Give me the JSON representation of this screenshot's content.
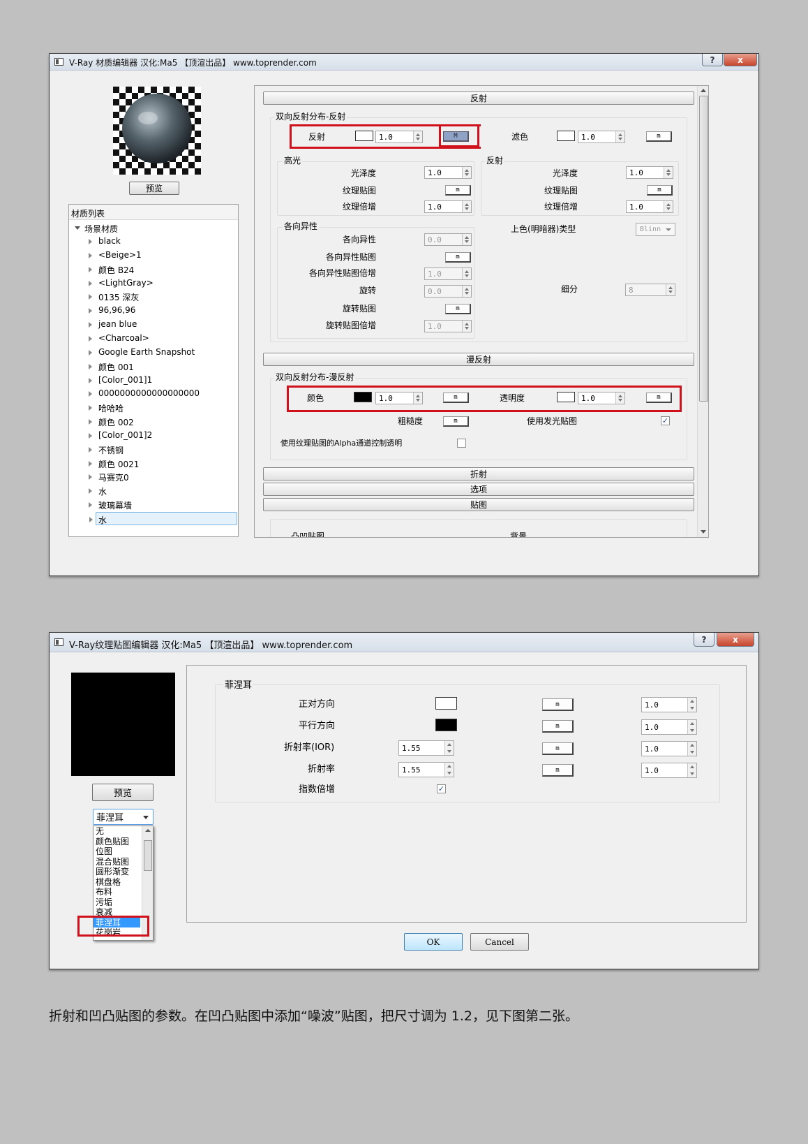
{
  "material_editor": {
    "title": "V-Ray 材质编辑器   汉化:Ma5   【顶渲出品】 www.toprender.com",
    "help_button": "?",
    "close_button": "x",
    "preview_button": "预览",
    "material_list": {
      "header": "材质列表",
      "root": "场景材质",
      "items": [
        "black",
        "<Beige>1",
        "颜色 B24",
        "<LightGray>",
        "0135 深灰",
        "96,96,96",
        "jean blue",
        "<Charcoal>",
        "Google Earth Snapshot",
        "颜色 001",
        "[Color_001]1",
        "0000000000000000000",
        "哈哈哈",
        "颜色 002",
        "[Color_001]2",
        "不锈钢",
        "颜色 0021",
        "马赛克0",
        "水",
        "玻璃幕墙",
        "水"
      ]
    },
    "reflection": {
      "rollout": "反射",
      "group": "双向反射分布-反射",
      "reflect_label": "反射",
      "reflect_value": "1.0",
      "reflect_map": "M",
      "filter_label": "滤色",
      "filter_value": "1.0",
      "filter_map": "m",
      "highlight": {
        "title": "高光",
        "gloss_label": "光泽度",
        "gloss_value": "1.0",
        "map_label": "纹理贴图",
        "map_btn": "m",
        "mult_label": "纹理倍增",
        "mult_value": "1.0"
      },
      "reflect_sub": {
        "title": "反射",
        "gloss_label": "光泽度",
        "gloss_value": "1.0",
        "map_label": "纹理贴图",
        "map_btn": "m",
        "mult_label": "纹理倍增",
        "mult_value": "1.0"
      },
      "anisotropy": {
        "title": "各向异性",
        "aniso_label": "各向异性",
        "aniso_value": "0.0",
        "aniso_map_label": "各向异性贴图",
        "aniso_map_btn": "m",
        "aniso_mult_label": "各向异性贴图倍增",
        "aniso_mult_value": "1.0",
        "rot_label": "旋转",
        "rot_value": "0.0",
        "rot_map_label": "旋转贴图",
        "rot_map_btn": "m",
        "rot_mult_label": "旋转贴图倍增",
        "rot_mult_value": "1.0"
      },
      "shader_type_label": "上色(明暗器)类型",
      "shader_type_value": "Blinn",
      "subdiv_label": "细分",
      "subdiv_value": "8"
    },
    "diffuse": {
      "rollout": "漫反射",
      "group": "双向反射分布-漫反射",
      "color_label": "颜色",
      "color_value": "1.0",
      "color_map": "m",
      "opacity_label": "透明度",
      "opacity_value": "1.0",
      "opacity_map": "m",
      "roughness_label": "粗糙度",
      "roughness_map": "m",
      "emissive_label": "使用发光贴图",
      "alpha_label": "使用纹理贴图的Alpha通道控制透明"
    },
    "rollouts": [
      "折射",
      "选项",
      "贴图"
    ],
    "cut_row": {
      "left": "凸凹贴图",
      "right": "背景"
    }
  },
  "texture_editor": {
    "title": "V-Ray纹理贴图编辑器   汉化:Ma5    【顶渲出品】 www.toprender.com",
    "help_button": "?",
    "close_button": "x",
    "preview_button": "预览",
    "type_selected": "菲涅耳",
    "type_options": [
      "无",
      "颜色贴图",
      "位图",
      "混合贴图",
      "圆形渐变",
      "棋盘格",
      "布料",
      "污垢",
      "衰减",
      "菲涅耳",
      "花岗岩"
    ],
    "group": "菲涅耳",
    "rows": [
      {
        "label": "正对方向",
        "map": "m",
        "mult": "1.0"
      },
      {
        "label": "平行方向",
        "map": "m",
        "mult": "1.0"
      },
      {
        "label": "折射率(IOR)",
        "value": "1.55",
        "map": "m",
        "mult": "1.0"
      },
      {
        "label": "折射率",
        "value": "1.55",
        "map": "m",
        "mult": "1.0"
      }
    ],
    "exp_mult_label": "指数倍增",
    "ok": "OK",
    "cancel": "Cancel"
  },
  "caption": "折射和凹凸贴图的参数。在凹凸贴图中添加“噪波”贴图，把尺寸调为 1.2，见下图第二张。",
  "colors": {
    "accent_red": "#d0101b",
    "selection": "#3399ff",
    "active_map": "#8ea3c6"
  }
}
